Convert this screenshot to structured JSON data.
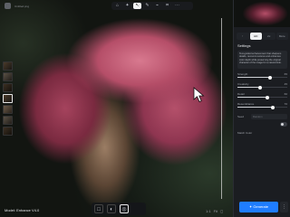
{
  "toolbar": {
    "file_label": "Untitled.png",
    "tools": [
      "⌂",
      "✦",
      "↖",
      "✎",
      "⌁",
      "⌗",
      "⋯"
    ],
    "active_tool_index": 2
  },
  "thumbs": [
    "",
    "",
    "",
    "",
    "",
    "",
    ""
  ],
  "model_label": "Model: Enhance V4.0",
  "bottom_bar": {
    "icons": [
      "□",
      "◐",
      "◎"
    ],
    "active_index": 2
  },
  "zoom": {
    "a": "1:1",
    "b": "Fit",
    "c": "◻"
  },
  "panel": {
    "tabs": [
      "↑",
      "HD",
      "2x",
      "More"
    ],
    "active_tab": 1,
    "section_title": "Settings",
    "description": "Text-guided enhancement that sharpens details, recovers textures and enhances color depth while preserving the original character of the image for a natural look.",
    "sliders": [
      {
        "label": "Strength",
        "value": "65",
        "fraction": 0.65
      },
      {
        "label": "Creativity",
        "value": "45",
        "fraction": 0.45
      },
      {
        "label": "Detail",
        "value": "60",
        "fraction": 0.6
      },
      {
        "label": "Resemblance",
        "value": "70",
        "fraction": 0.7
      }
    ],
    "seed_label": "Seed",
    "seed_placeholder": "Random",
    "toggle_label": "Match Color",
    "cta_label": "✦ Generate",
    "cta_side": "⋮"
  }
}
